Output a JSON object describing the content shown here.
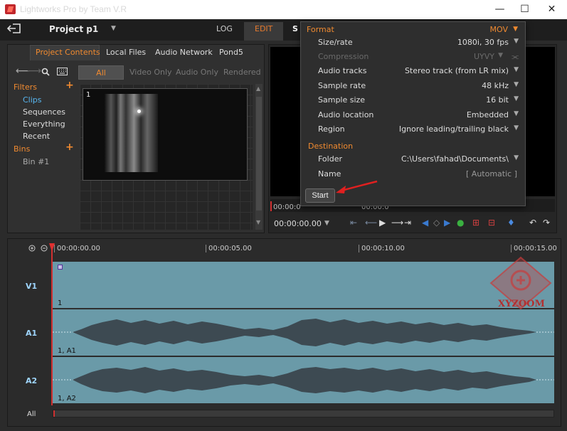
{
  "window": {
    "title": "Lightworks Pro by Team V.R",
    "minimize_glyph": "—",
    "maximize_glyph": "☐",
    "close_glyph": "✕"
  },
  "toolbar": {
    "project_title": "Project p1",
    "tabs": [
      "LOG",
      "EDIT",
      "S"
    ]
  },
  "project_panel": {
    "tabs": [
      "Project Contents",
      "Local Files",
      "Audio Network",
      "Pond5"
    ],
    "filters_header": "Filters",
    "filters": [
      "Clips",
      "Sequences",
      "Everything",
      "Recent"
    ],
    "bins_header": "Bins",
    "bins": [
      "Bin #1"
    ],
    "filter_tabs": [
      "All",
      "Video Only",
      "Audio Only",
      "Rendered"
    ],
    "thumbnail_label": "1"
  },
  "viewer": {
    "timeline_time_1": "00:00:0",
    "timeline_time_2": "00:00:0",
    "timecode": "00:00:00.00"
  },
  "export_popup": {
    "format_header": "Format",
    "format_value": "MOV",
    "rows": [
      {
        "label": "Size/rate",
        "value": "1080i, 30 fps",
        "disabled": false
      },
      {
        "label": "Compression",
        "value": "UYVY",
        "disabled": true
      },
      {
        "label": "Audio tracks",
        "value": "Stereo track (from LR mix)",
        "disabled": false
      },
      {
        "label": "Sample rate",
        "value": "48 kHz",
        "disabled": false
      },
      {
        "label": "Sample size",
        "value": "16 bit",
        "disabled": false
      },
      {
        "label": "Audio location",
        "value": "Embedded",
        "disabled": false
      },
      {
        "label": "Region",
        "value": "Ignore leading/trailing black",
        "disabled": false
      }
    ],
    "destination_header": "Destination",
    "folder_label": "Folder",
    "folder_value": "C:\\Users\\fahad\\Documents\\",
    "name_label": "Name",
    "name_value": "[ Automatic ]",
    "start_label": "Start"
  },
  "timeline": {
    "ruler": [
      "00:00:00.00",
      "00:00:05.00",
      "00:00:10.00",
      "00:00:15.00"
    ],
    "tracks": [
      {
        "label": "V1",
        "clip": "1"
      },
      {
        "label": "A1",
        "clip": "1, A1"
      },
      {
        "label": "A2",
        "clip": "1, A2"
      }
    ],
    "all_label": "All"
  },
  "watermark": {
    "text": "XYZOOM"
  },
  "colors": {
    "accent": "#f08a30",
    "track": "#6a9aa8",
    "playhead": "#d03030",
    "annotation_arrow": "#e02020"
  }
}
